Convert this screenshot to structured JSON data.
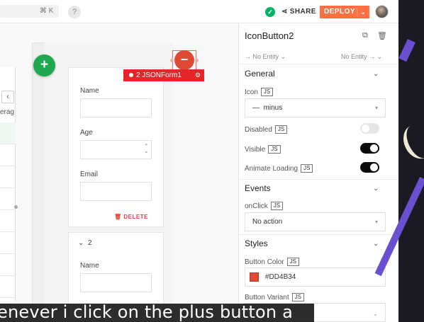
{
  "topbar": {
    "shortcut": "⌘ K",
    "help": "?",
    "share_label": "SHARE",
    "deploy_label": "DEPLOY"
  },
  "canvas": {
    "left_cell_text": "erag",
    "add_button_icon": "+",
    "remove_button_icon": "−",
    "widget_tag": "2  JSONForm1",
    "form": {
      "name_label": "Name",
      "age_label": "Age",
      "email_label": "Email",
      "delete_label": "DELETE",
      "item2_label": "2",
      "item2_name_label": "Name"
    }
  },
  "properties": {
    "widget_name": "IconButton2",
    "no_entity_left": "→ No Entity ⌄",
    "no_entity_right": "No Entity → ⌄",
    "general": "General",
    "icon_label": "Icon",
    "icon_value": "minus",
    "disabled_label": "Disabled",
    "visible_label": "Visible",
    "animate_loading_label": "Animate Loading",
    "events": "Events",
    "onclick_label": "onClick",
    "onclick_value": "No action",
    "styles": "Styles",
    "button_color_label": "Button Color",
    "button_color_value": "#DD4B34",
    "button_variant_label": "Button Variant",
    "js": "JS",
    "toggles": {
      "disabled": false,
      "visible": true,
      "animate_loading": true
    }
  },
  "caption": "enever i click on the plus button a",
  "colors": {
    "accent": "#fe6f43",
    "button_color": "#DD4B34",
    "add_button": "#1fa84f",
    "selection": "#e5252a"
  }
}
